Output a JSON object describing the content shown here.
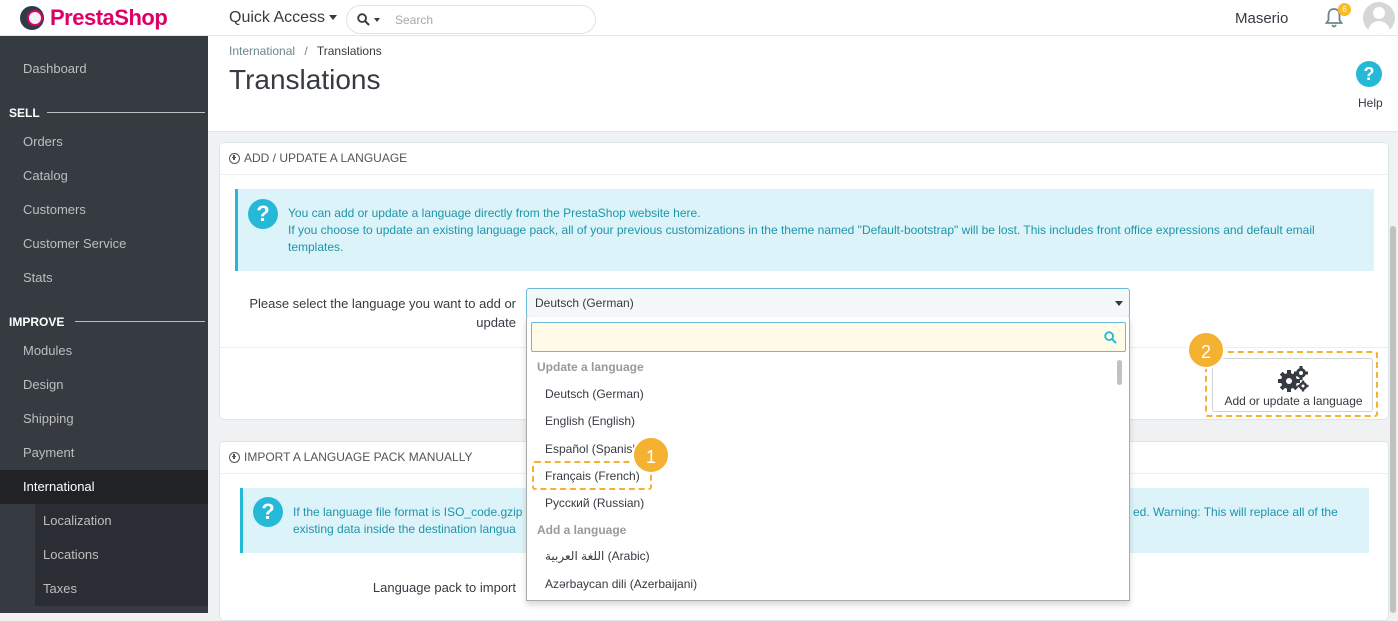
{
  "topbar": {
    "logo_text": "PrestaShop",
    "quick_access_label": "Quick Access",
    "search_placeholder": "Search",
    "user_name": "Maserio",
    "notification_count": "6"
  },
  "sidebar": {
    "dashboard": "Dashboard",
    "section_sell": "SELL",
    "sell_items": [
      "Orders",
      "Catalog",
      "Customers",
      "Customer Service",
      "Stats"
    ],
    "section_improve": "IMPROVE",
    "improve_items": [
      "Modules",
      "Design",
      "Shipping",
      "Payment",
      "International"
    ],
    "international_sub": [
      "Localization",
      "Locations",
      "Taxes"
    ]
  },
  "header": {
    "breadcrumb_parent": "International",
    "breadcrumb_sep": "/",
    "breadcrumb_current": "Translations",
    "title": "Translations",
    "help_label": "Help"
  },
  "panel_add": {
    "heading": "ADD / UPDATE A LANGUAGE",
    "alert_line1": "You can add or update a language directly from the PrestaShop website here.",
    "alert_line2": "If you choose to update an existing language pack, all of your previous customizations in the theme named \"Default-bootstrap\" will be lost. This includes front office expressions and default email templates.",
    "select_label": "Please select the language you want to add or update",
    "select_value": "Deutsch (German)",
    "button_label": "Add or update a language"
  },
  "dropdown": {
    "group_update": "Update a language",
    "update_options": [
      "Deutsch (German)",
      "English (English)",
      "Español (Spanish)",
      "Français (French)",
      "Русский (Russian)"
    ],
    "group_add": "Add a language",
    "add_options": [
      "اللغة العربية (Arabic)",
      "Azərbaycan dili (Azerbaijani)"
    ]
  },
  "panel_import": {
    "heading": "IMPORT A LANGUAGE PACK MANUALLY",
    "alert_line1_start": "If the language file format is ISO_code.gzip",
    "alert_line1_end": "ed. Warning: This will replace all of the",
    "alert_line2": "existing data inside the destination langua",
    "pack_label": "Language pack to import"
  },
  "annotations": {
    "step1": "1",
    "step2": "2"
  },
  "colors": {
    "brand": "#df0067",
    "sidebar_bg": "#363a41",
    "accent": "#25b9d7",
    "highlight": "#f5b131"
  }
}
